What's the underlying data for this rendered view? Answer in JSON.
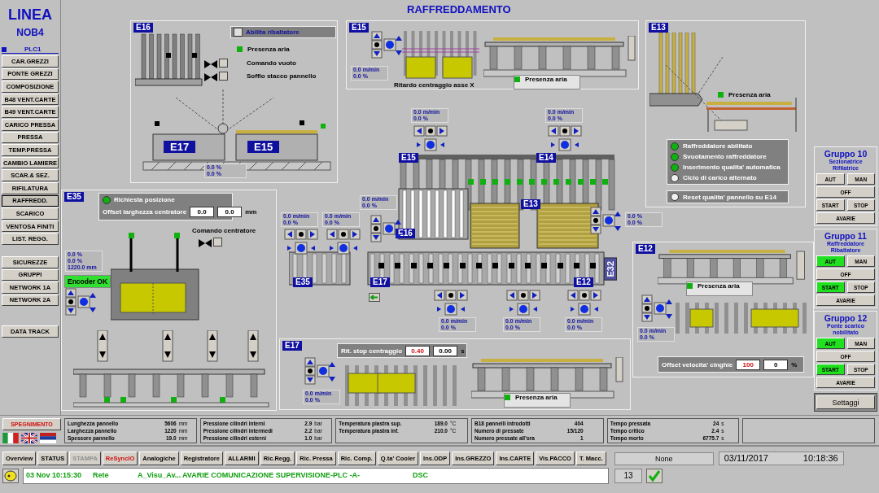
{
  "header": {
    "line": "LINEA",
    "code": "NOB4",
    "plc": "PLC1",
    "title": "RAFFREDDAMENTO"
  },
  "menu": [
    {
      "label": "CAR.GREZZI",
      "selected": false
    },
    {
      "label": "PONTE GREZZI",
      "selected": false
    },
    {
      "label": "COMPOSIZIONE",
      "selected": false
    },
    {
      "label": "B48 VENT.CARTE",
      "selected": false
    },
    {
      "label": "B49 VENT.CARTE",
      "selected": false
    },
    {
      "label": "CARICO PRESSA",
      "selected": false
    },
    {
      "label": "PRESSA",
      "selected": false
    },
    {
      "label": "TEMP.PRESSA",
      "selected": false
    },
    {
      "label": "CAMBIO LAMIERE",
      "selected": false
    },
    {
      "label": "SCAR.& SEZ.",
      "selected": false
    },
    {
      "label": "RIFILATURA",
      "selected": false
    },
    {
      "label": "RAFFREDD.",
      "selected": true
    },
    {
      "label": "SCARICO",
      "selected": false
    },
    {
      "label": "VENTOSA FINITI",
      "selected": false
    },
    {
      "label": "LIST. REGG.",
      "selected": false
    }
  ],
  "menu_lower": [
    "SICUREZZE",
    "GRUPPI",
    "NETWORK 1A",
    "NETWORK 2A"
  ],
  "data_track": "DATA TRACK",
  "e16": {
    "tag": "E16",
    "toggle": {
      "label": "Abilita ribaltatore",
      "checked": false
    },
    "air": {
      "label": "Presenza aria",
      "on": true
    },
    "commands": [
      "Comando vuoto",
      "Soffio stacco pannello"
    ],
    "stations": [
      "E17",
      "E15"
    ],
    "readouts": [
      "0.0 %",
      "0.0 %"
    ]
  },
  "e15": {
    "tag": "E15",
    "readouts": [
      "0.0 m/min",
      "0.0 %"
    ],
    "caption": "Ritardo centraggio asse X",
    "air": {
      "label": "Presenza aria",
      "on": true
    }
  },
  "e13": {
    "tag": "E13",
    "air": {
      "label": "Presenza aria",
      "on": true
    },
    "status": [
      {
        "label": "Raffreddatore abilitato",
        "on": true
      },
      {
        "label": "Svuotamento raffreddatore",
        "on": true
      },
      {
        "label": "Inserimento qualita' automatica",
        "on": true
      },
      {
        "label": "Ciclo di carico alternato",
        "on": false
      }
    ],
    "reset": "Reset qualita' pannello su E14"
  },
  "conveyor": {
    "tags": [
      "E15",
      "E14",
      "E13",
      "E16",
      "E35",
      "E17",
      "E12",
      "E32"
    ],
    "readouts": [
      [
        "0.0 m/min",
        "0.0 %"
      ],
      [
        "0.0 m/min",
        "0.0 %"
      ],
      [
        "0.0 m/min",
        "0.0 %"
      ],
      [
        "0.0 m/min",
        "0.0 %"
      ],
      [
        "0.0 m/min",
        "0.0 %"
      ],
      [
        "0.0 %",
        "0.0 %"
      ],
      [
        "0.0 m/min",
        "0.0 %"
      ],
      [
        "0.0 m/min",
        "0.0 %"
      ],
      [
        "0.0 m/min",
        "0.0 %"
      ]
    ]
  },
  "e35": {
    "tag": "E35",
    "request": {
      "label": "Richiesta posizione",
      "on": true
    },
    "offset": {
      "label": "Offset larghezza centratore",
      "values": [
        "0.0",
        "0.0"
      ],
      "unit": "mm"
    },
    "centering": "Comando centratore",
    "readouts": [
      "0.0 %",
      "0.0 %",
      "1220.0 mm"
    ],
    "encoder": "Encoder OK"
  },
  "e17": {
    "tag": "E17",
    "delay": {
      "label": "Rit. stop centraggio",
      "values": [
        "0.40",
        "0.00"
      ],
      "unit": "s"
    },
    "readouts": [
      "0.0 m/min",
      "0.0 %"
    ],
    "air": {
      "label": "Presenza aria",
      "on": true
    }
  },
  "e12": {
    "tag": "E12",
    "air": {
      "label": "Presenza aria",
      "on": true
    },
    "readouts": [
      "0.0 m/min",
      "0.0 %"
    ],
    "offset": {
      "label": "Offset velocita' cinghie",
      "values": [
        "100",
        "0"
      ],
      "unit": "%"
    }
  },
  "groups": [
    {
      "title": "Gruppo 10",
      "subtitle": "Sezionatrice Rifilatrice",
      "buttons": [
        {
          "label": "AUT",
          "on": false
        },
        {
          "label": "MAN",
          "on": false
        },
        {
          "label": "OFF",
          "on": false
        },
        {
          "label": "START",
          "on": false
        },
        {
          "label": "STOP",
          "on": false
        },
        {
          "label": "AVARIE",
          "on": false
        }
      ]
    },
    {
      "title": "Gruppo 11",
      "subtitle": "Raffreddatore Ribaltatore",
      "buttons": [
        {
          "label": "AUT",
          "on": true
        },
        {
          "label": "MAN",
          "on": false
        },
        {
          "label": "OFF",
          "on": false
        },
        {
          "label": "START",
          "on": true
        },
        {
          "label": "STOP",
          "on": false
        },
        {
          "label": "AVARIE",
          "on": false
        }
      ]
    },
    {
      "title": "Gruppo 12",
      "subtitle": "Ponte scarico nobilitato",
      "buttons": [
        {
          "label": "AUT",
          "on": true
        },
        {
          "label": "MAN",
          "on": false
        },
        {
          "label": "OFF",
          "on": false
        },
        {
          "label": "START",
          "on": true
        },
        {
          "label": "STOP",
          "on": false
        },
        {
          "label": "AVARIE",
          "on": false
        }
      ]
    }
  ],
  "settings": "Settaggi",
  "shutdown": "SPEGNIMENTO",
  "info_panels": [
    [
      {
        "label": "Lunghezza pannello",
        "value": "5606",
        "unit": "mm"
      },
      {
        "label": "Larghezza pannello",
        "value": "1220",
        "unit": "mm"
      },
      {
        "label": "Spessore pannello",
        "value": "19.0",
        "unit": "mm"
      }
    ],
    [
      {
        "label": "Pressione cilindri interni",
        "value": "2.9",
        "unit": "bar"
      },
      {
        "label": "Pressione cilindri intermedi",
        "value": "2.2",
        "unit": "bar"
      },
      {
        "label": "Pressione cilindri esterni",
        "value": "1.0",
        "unit": "bar"
      }
    ],
    [
      {
        "label": "Temperatura piastra sup.",
        "value": "189.0",
        "unit": "°C"
      },
      {
        "label": "Temperatura piastra inf.",
        "value": "210.0",
        "unit": "°C"
      }
    ],
    [
      {
        "label": "B18 pannelli introdotti",
        "value": "404"
      },
      {
        "label": "Numero di pressate",
        "value": "15/120"
      },
      {
        "label": "Numero pressate all'ora",
        "value": "1"
      }
    ],
    [
      {
        "label": "Tempo pressata",
        "value": "24",
        "unit": "s"
      },
      {
        "label": "Tempo critico",
        "value": "2.4",
        "unit": "s"
      },
      {
        "label": "Tempo morto",
        "value": "6775.7",
        "unit": "s"
      }
    ]
  ],
  "nav": [
    {
      "label": "Overview",
      "disabled": false,
      "alert": false
    },
    {
      "label": "STATUS",
      "disabled": false,
      "alert": false
    },
    {
      "label": "STAMPA",
      "disabled": true,
      "alert": false
    },
    {
      "label": "ReSyncIO",
      "disabled": false,
      "alert": true
    },
    {
      "label": "Analogiche",
      "disabled": false,
      "alert": false
    },
    {
      "label": "Registratore",
      "disabled": false,
      "alert": false
    },
    {
      "label": "ALLARMI",
      "disabled": false,
      "alert": false
    },
    {
      "label": "Ric.Regg.",
      "disabled": false,
      "alert": false
    },
    {
      "label": "Ric. Pressa",
      "disabled": false,
      "alert": false
    },
    {
      "label": "Ric. Comp.",
      "disabled": false,
      "alert": false
    },
    {
      "label": "Q.ta' Cooler",
      "disabled": false,
      "alert": false
    },
    {
      "label": "Ins.ODP",
      "disabled": false,
      "alert": false
    },
    {
      "label": "Ins.GREZZO",
      "disabled": false,
      "alert": false
    },
    {
      "label": "Ins.CARTE",
      "disabled": false,
      "alert": false
    },
    {
      "label": "Vis.PACCO",
      "disabled": false,
      "alert": false
    },
    {
      "label": "T. Macc.",
      "disabled": false,
      "alert": false
    }
  ],
  "status_field": "None",
  "date": "03/11/2017",
  "time": "10:18:36",
  "alarm": {
    "date": "03 Nov",
    "time": "10:15:30",
    "area": "Rete",
    "tag": "A_Visu_Av...",
    "message": "AVARIE COMUNICAZIONE SUPERVISIONE-PLC -A-",
    "source": "DSC",
    "count": "13",
    "acknowledged": true
  }
}
